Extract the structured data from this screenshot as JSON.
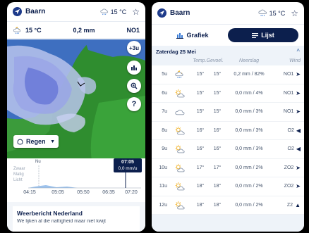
{
  "header": {
    "location": "Baarn",
    "temperature": "15 °C",
    "favorite_icon": "star-icon"
  },
  "left": {
    "summary": {
      "temp": "15 °C",
      "rain": "0,2 mm",
      "wind": "NO1"
    },
    "map_buttons": {
      "zoom_level": "+3u"
    },
    "layer_button": "Regen",
    "timeline": {
      "legend": [
        "Zwaar",
        "Matig",
        "Licht"
      ],
      "now_label": "Nu",
      "selected_time": "07:05",
      "selected_rate": "0,0 mm/u",
      "ticks": [
        "04:15",
        "05:05",
        "05:50",
        "06:35",
        "07:20"
      ]
    },
    "article": {
      "title": "Weerbericht Nederland",
      "text": "We lijken al die nattigheid maar niet kwijt"
    }
  },
  "right": {
    "tabs": {
      "chart": "Grafiek",
      "list": "Lijst"
    },
    "day": "Zaterdag 25 Mei",
    "columns": {
      "temp": "Temp.",
      "feel": "Gevoel.",
      "rain": "Neerslag",
      "wind": "Wind"
    },
    "rows": [
      {
        "hour": "5u",
        "icon": "night-rain-icon",
        "temp": "15°",
        "feel": "15°",
        "rain": "0,2 mm / 82%",
        "wind": "NO1",
        "dir": "➤"
      },
      {
        "hour": "6u",
        "icon": "sun-cloud-icon",
        "temp": "15°",
        "feel": "15°",
        "rain": "0,0 mm / 4%",
        "wind": "NO1",
        "dir": "➤"
      },
      {
        "hour": "7u",
        "icon": "cloud-icon",
        "temp": "15°",
        "feel": "15°",
        "rain": "0,0 mm / 3%",
        "wind": "NO1",
        "dir": "➤"
      },
      {
        "hour": "8u",
        "icon": "sun-cloud-icon",
        "temp": "16°",
        "feel": "16°",
        "rain": "0,0 mm / 3%",
        "wind": "O2",
        "dir": "◀"
      },
      {
        "hour": "9u",
        "icon": "sun-cloud-icon",
        "temp": "16°",
        "feel": "16°",
        "rain": "0,0 mm / 3%",
        "wind": "O2",
        "dir": "◀"
      },
      {
        "hour": "10u",
        "icon": "sun-cloud-icon",
        "temp": "17°",
        "feel": "17°",
        "rain": "0,0 mm / 2%",
        "wind": "ZO2",
        "dir": "➤"
      },
      {
        "hour": "11u",
        "icon": "sun-cloud-icon",
        "temp": "18°",
        "feel": "18°",
        "rain": "0,0 mm / 2%",
        "wind": "ZO2",
        "dir": "➤"
      },
      {
        "hour": "12u",
        "icon": "sun-cloud-icon",
        "temp": "18°",
        "feel": "18°",
        "rain": "0,0 mm / 2%",
        "wind": "Z2",
        "dir": "▲"
      }
    ]
  }
}
